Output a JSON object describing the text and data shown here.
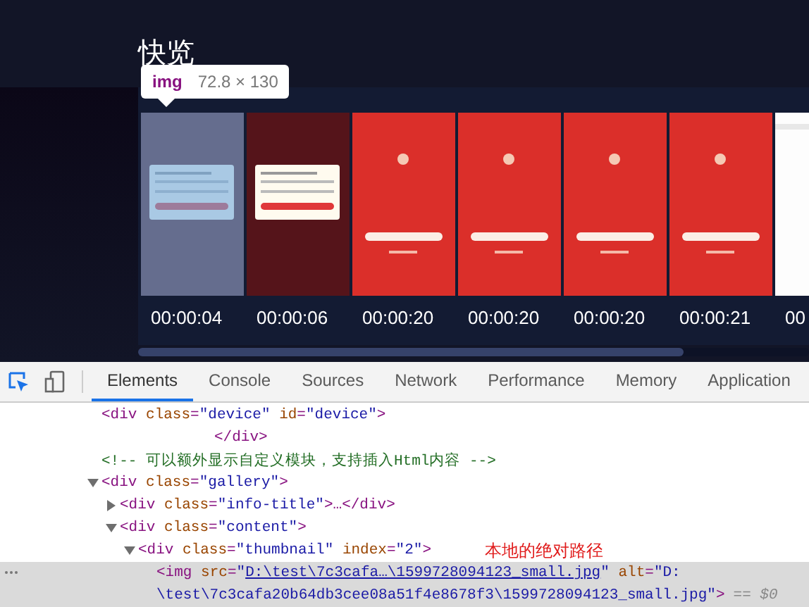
{
  "preview": {
    "title": "快览",
    "inspect_tooltip": {
      "tag": "img",
      "size": "72.8 × 130"
    },
    "thumbnails": [
      {
        "kind": "dialog",
        "highlighted": true,
        "timestamp": "00:00:04"
      },
      {
        "kind": "dialog",
        "highlighted": false,
        "timestamp": "00:00:06"
      },
      {
        "kind": "splash",
        "highlighted": false,
        "timestamp": "00:00:20"
      },
      {
        "kind": "splash",
        "highlighted": false,
        "timestamp": "00:00:20"
      },
      {
        "kind": "splash",
        "highlighted": false,
        "timestamp": "00:00:20"
      },
      {
        "kind": "splash",
        "highlighted": false,
        "timestamp": "00:00:21"
      },
      {
        "kind": "blank",
        "highlighted": false,
        "timestamp": "00"
      }
    ]
  },
  "devtools": {
    "tabs": [
      {
        "label": "Elements",
        "selected": true
      },
      {
        "label": "Console",
        "selected": false
      },
      {
        "label": "Sources",
        "selected": false
      },
      {
        "label": "Network",
        "selected": false
      },
      {
        "label": "Performance",
        "selected": false
      },
      {
        "label": "Memory",
        "selected": false
      },
      {
        "label": "Application",
        "selected": false
      }
    ],
    "dom_tree": [
      {
        "kind": "element",
        "selected": false,
        "lines": [
          [
            {
              "kind": "tag",
              "s": "<div"
            },
            {
              "kind": "attr",
              "s": " class"
            },
            {
              "kind": "tag",
              "s": "="
            },
            {
              "kind": "value",
              "s": "\"device\""
            },
            {
              "kind": "attr",
              "s": " id"
            },
            {
              "kind": "tag",
              "s": "="
            },
            {
              "kind": "value",
              "s": "\"device\""
            },
            {
              "kind": "tag",
              "s": ">"
            }
          ]
        ],
        "children": [
          {
            "kind": "closing",
            "selected": false,
            "lines": [
              [
                {
                  "kind": "tag",
                  "s": "</div>"
                }
              ]
            ]
          }
        ]
      },
      {
        "kind": "element",
        "selected": false,
        "lines": [
          [
            {
              "kind": "comment",
              "s": "<!-- 可以额外显示自定义模块，支持插入Html内容 -->"
            }
          ]
        ]
      },
      {
        "kind": "element",
        "selected": false,
        "expanded": true,
        "lines": [
          [
            {
              "kind": "tag",
              "s": "<div"
            },
            {
              "kind": "attr",
              "s": " class"
            },
            {
              "kind": "tag",
              "s": "="
            },
            {
              "kind": "value",
              "s": "\"gallery\""
            },
            {
              "kind": "tag",
              "s": ">"
            }
          ]
        ],
        "children": [
          {
            "kind": "element",
            "selected": false,
            "expanded": false,
            "lines": [
              [
                {
                  "kind": "tag",
                  "s": "<div"
                },
                {
                  "kind": "attr",
                  "s": " class"
                },
                {
                  "kind": "tag",
                  "s": "="
                },
                {
                  "kind": "value",
                  "s": "\"info-title\""
                },
                {
                  "kind": "tag",
                  "s": ">…</div>"
                }
              ]
            ]
          },
          {
            "kind": "element",
            "selected": false,
            "expanded": true,
            "lines": [
              [
                {
                  "kind": "tag",
                  "s": "<div"
                },
                {
                  "kind": "attr",
                  "s": " class"
                },
                {
                  "kind": "tag",
                  "s": "="
                },
                {
                  "kind": "value",
                  "s": "\"content\""
                },
                {
                  "kind": "tag",
                  "s": ">"
                }
              ]
            ],
            "children": [
              {
                "kind": "element",
                "selected": false,
                "expanded": true,
                "note": "本地的绝对路径",
                "lines": [
                  [
                    {
                      "kind": "tag",
                      "s": "<div"
                    },
                    {
                      "kind": "attr",
                      "s": " class"
                    },
                    {
                      "kind": "tag",
                      "s": "="
                    },
                    {
                      "kind": "value",
                      "s": "\"thumbnail\""
                    },
                    {
                      "kind": "attr",
                      "s": " index"
                    },
                    {
                      "kind": "tag",
                      "s": "="
                    },
                    {
                      "kind": "value",
                      "s": "\"2\""
                    },
                    {
                      "kind": "tag",
                      "s": ">"
                    }
                  ]
                ],
                "children": [
                  {
                    "kind": "element",
                    "selected": true,
                    "marker": "== $0",
                    "lines": [
                      [
                        {
                          "kind": "tag",
                          "s": "<img"
                        },
                        {
                          "kind": "attr",
                          "s": " src"
                        },
                        {
                          "kind": "tag",
                          "s": "="
                        },
                        {
                          "kind": "value",
                          "s": "\""
                        },
                        {
                          "kind": "link",
                          "s": "D:\\test\\7c3cafa…\\1599728094123_small.jpg"
                        },
                        {
                          "kind": "value",
                          "s": "\""
                        },
                        {
                          "kind": "attr",
                          "s": " alt"
                        },
                        {
                          "kind": "tag",
                          "s": "="
                        },
                        {
                          "kind": "value",
                          "s": "\"D:"
                        }
                      ],
                      [
                        {
                          "kind": "value",
                          "s": "\\test\\7c3cafa20b64db3cee08a51f4e8678f3\\1599728094123_small.jpg\""
                        },
                        {
                          "kind": "tag",
                          "s": ">"
                        }
                      ]
                    ]
                  }
                ]
              }
            ]
          }
        ]
      }
    ]
  }
}
